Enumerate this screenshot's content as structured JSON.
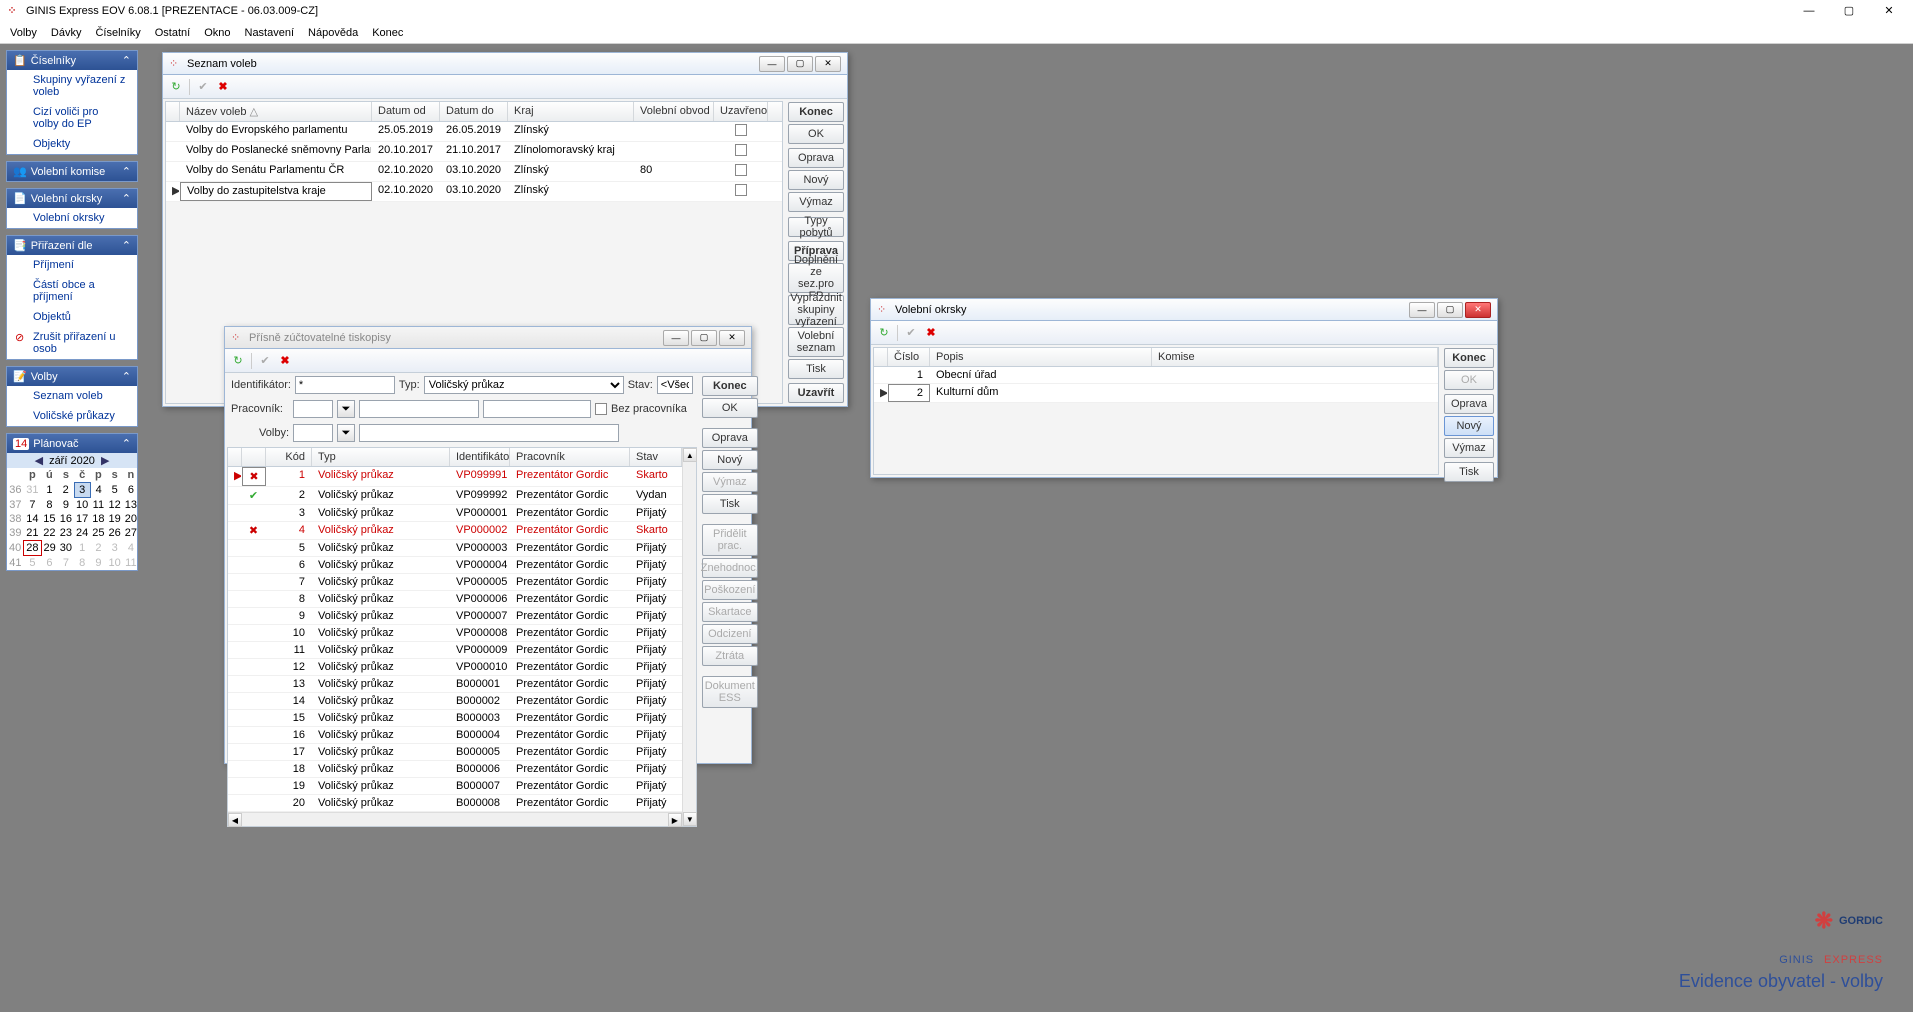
{
  "app": {
    "title": "GINIS Express EOV 6.08.1 [PREZENTACE - 06.03.009-CZ]"
  },
  "menu": [
    "Volby",
    "Dávky",
    "Číselníky",
    "Ostatní",
    "Okno",
    "Nastavení",
    "Nápověda",
    "Konec"
  ],
  "sidebar": {
    "ciselniky": {
      "title": "Číselníky",
      "items": [
        "Skupiny vyřazení z voleb",
        "Cizí voliči pro volby do EP",
        "Objekty"
      ]
    },
    "komise": {
      "title": "Volební komise"
    },
    "okrsky": {
      "title": "Volební okrsky",
      "items": [
        "Volební okrsky"
      ]
    },
    "prirazeni": {
      "title": "Přiřazení dle",
      "items": [
        "Příjmení",
        "Částí obce a příjmení",
        "Objektů",
        "Zrušit přiřazení u osob"
      ]
    },
    "volby": {
      "title": "Volby",
      "items": [
        "Seznam voleb",
        "Voličské průkazy"
      ]
    },
    "planovac": {
      "title": "Plánovač",
      "month": "září 2020"
    }
  },
  "calendar": {
    "days": [
      "p",
      "ú",
      "s",
      "č",
      "p",
      "s",
      "n"
    ],
    "weeks": [
      {
        "wk": "36",
        "d": [
          "31",
          "1",
          "2",
          "3",
          "4",
          "5",
          "6"
        ],
        "flags": [
          "out",
          "",
          "",
          "sel",
          "",
          "",
          ""
        ]
      },
      {
        "wk": "37",
        "d": [
          "7",
          "8",
          "9",
          "10",
          "11",
          "12",
          "13"
        ]
      },
      {
        "wk": "38",
        "d": [
          "14",
          "15",
          "16",
          "17",
          "18",
          "19",
          "20"
        ]
      },
      {
        "wk": "39",
        "d": [
          "21",
          "22",
          "23",
          "24",
          "25",
          "26",
          "27"
        ]
      },
      {
        "wk": "40",
        "d": [
          "28",
          "29",
          "30",
          "1",
          "2",
          "3",
          "4"
        ],
        "flags": [
          "today",
          "",
          "",
          "out",
          "out",
          "out",
          "out"
        ]
      },
      {
        "wk": "41",
        "d": [
          "5",
          "6",
          "7",
          "8",
          "9",
          "10",
          "11"
        ],
        "flags": [
          "out",
          "out",
          "out",
          "out",
          "out",
          "out",
          "out"
        ]
      }
    ]
  },
  "win_seznam": {
    "title": "Seznam voleb",
    "cols": [
      "Název voleb",
      "Datum od",
      "Datum do",
      "Kraj",
      "Volební obvod",
      "Uzavřeno"
    ],
    "rows": [
      {
        "nazev": "Volby do Evropského parlamentu",
        "od": "25.05.2019",
        "do": "26.05.2019",
        "kraj": "Zlínský",
        "obvod": "",
        "uz": false
      },
      {
        "nazev": "Volby do Poslanecké sněmovny Parlamentu ČR",
        "od": "20.10.2017",
        "do": "21.10.2017",
        "kraj": "Zlínolomoravský kraj",
        "obvod": "",
        "uz": false
      },
      {
        "nazev": "Volby do Senátu Parlamentu ČR",
        "od": "02.10.2020",
        "do": "03.10.2020",
        "kraj": "Zlínský",
        "obvod": "80",
        "uz": false
      },
      {
        "nazev": "Volby do zastupitelstva kraje",
        "od": "02.10.2020",
        "do": "03.10.2020",
        "kraj": "Zlínský",
        "obvod": "",
        "uz": false,
        "sel": true
      }
    ],
    "btns": {
      "konec": "Konec",
      "ok": "OK",
      "oprava": "Oprava",
      "novy": "Nový",
      "vymaz": "Výmaz",
      "typy": "Typy pobytů",
      "priprava": "Příprava",
      "doplneni": "Doplnění ze sez.pro EP",
      "vyprazdnit": "Vyprázdnit skupiny vyřazení",
      "seznam": "Volební seznam",
      "tisk": "Tisk",
      "uzavrit": "Uzavřít"
    }
  },
  "win_okrsky": {
    "title": "Volební okrsky",
    "cols": [
      "Číslo",
      "Popis",
      "Komise"
    ],
    "rows": [
      {
        "cislo": "1",
        "popis": "Obecní úřad",
        "komise": ""
      },
      {
        "cislo": "2",
        "popis": "Kulturní dům",
        "komise": "",
        "sel": true
      }
    ],
    "btns": {
      "konec": "Konec",
      "ok": "OK",
      "oprava": "Oprava",
      "novy": "Nový",
      "vymaz": "Výmaz",
      "tisk": "Tisk"
    }
  },
  "win_tiskopisy": {
    "title": "Přísně zúčtovatelné tiskopisy",
    "filter": {
      "ident_label": "Identifikátor:",
      "ident_val": "*",
      "typ_label": "Typ:",
      "typ_val": "Voličský průkaz",
      "stav_label": "Stav:",
      "stav_val": "<Všec",
      "prac_label": "Pracovník:",
      "bez_prac": "Bez pracovníka",
      "volby_label": "Volby:"
    },
    "cols": [
      "",
      "Kód",
      "Typ",
      "Identifikátor",
      "Pracovník",
      "Stav"
    ],
    "rows": [
      {
        "ico": "x",
        "kod": "1",
        "typ": "Voličský průkaz",
        "id": "VP099991",
        "prac": "Prezentátor Gordic",
        "stav": "Skarto",
        "red": true,
        "sel": true
      },
      {
        "ico": "v",
        "kod": "2",
        "typ": "Voličský průkaz",
        "id": "VP099992",
        "prac": "Prezentátor Gordic",
        "stav": "Vydan"
      },
      {
        "ico": "",
        "kod": "3",
        "typ": "Voličský průkaz",
        "id": "VP000001",
        "prac": "Prezentátor Gordic",
        "stav": "Přijatý"
      },
      {
        "ico": "x",
        "kod": "4",
        "typ": "Voličský průkaz",
        "id": "VP000002",
        "prac": "Prezentátor Gordic",
        "stav": "Skarto",
        "red": true
      },
      {
        "ico": "",
        "kod": "5",
        "typ": "Voličský průkaz",
        "id": "VP000003",
        "prac": "Prezentátor Gordic",
        "stav": "Přijatý"
      },
      {
        "ico": "",
        "kod": "6",
        "typ": "Voličský průkaz",
        "id": "VP000004",
        "prac": "Prezentátor Gordic",
        "stav": "Přijatý"
      },
      {
        "ico": "",
        "kod": "7",
        "typ": "Voličský průkaz",
        "id": "VP000005",
        "prac": "Prezentátor Gordic",
        "stav": "Přijatý"
      },
      {
        "ico": "",
        "kod": "8",
        "typ": "Voličský průkaz",
        "id": "VP000006",
        "prac": "Prezentátor Gordic",
        "stav": "Přijatý"
      },
      {
        "ico": "",
        "kod": "9",
        "typ": "Voličský průkaz",
        "id": "VP000007",
        "prac": "Prezentátor Gordic",
        "stav": "Přijatý"
      },
      {
        "ico": "",
        "kod": "10",
        "typ": "Voličský průkaz",
        "id": "VP000008",
        "prac": "Prezentátor Gordic",
        "stav": "Přijatý"
      },
      {
        "ico": "",
        "kod": "11",
        "typ": "Voličský průkaz",
        "id": "VP000009",
        "prac": "Prezentátor Gordic",
        "stav": "Přijatý"
      },
      {
        "ico": "",
        "kod": "12",
        "typ": "Voličský průkaz",
        "id": "VP000010",
        "prac": "Prezentátor Gordic",
        "stav": "Přijatý"
      },
      {
        "ico": "",
        "kod": "13",
        "typ": "Voličský průkaz",
        "id": "B000001",
        "prac": "Prezentátor Gordic",
        "stav": "Přijatý"
      },
      {
        "ico": "",
        "kod": "14",
        "typ": "Voličský průkaz",
        "id": "B000002",
        "prac": "Prezentátor Gordic",
        "stav": "Přijatý"
      },
      {
        "ico": "",
        "kod": "15",
        "typ": "Voličský průkaz",
        "id": "B000003",
        "prac": "Prezentátor Gordic",
        "stav": "Přijatý"
      },
      {
        "ico": "",
        "kod": "16",
        "typ": "Voličský průkaz",
        "id": "B000004",
        "prac": "Prezentátor Gordic",
        "stav": "Přijatý"
      },
      {
        "ico": "",
        "kod": "17",
        "typ": "Voličský průkaz",
        "id": "B000005",
        "prac": "Prezentátor Gordic",
        "stav": "Přijatý"
      },
      {
        "ico": "",
        "kod": "18",
        "typ": "Voličský průkaz",
        "id": "B000006",
        "prac": "Prezentátor Gordic",
        "stav": "Přijatý"
      },
      {
        "ico": "",
        "kod": "19",
        "typ": "Voličský průkaz",
        "id": "B000007",
        "prac": "Prezentátor Gordic",
        "stav": "Přijatý"
      },
      {
        "ico": "",
        "kod": "20",
        "typ": "Voličský průkaz",
        "id": "B000008",
        "prac": "Prezentátor Gordic",
        "stav": "Přijatý"
      }
    ],
    "btns": {
      "konec": "Konec",
      "ok": "OK",
      "oprava": "Oprava",
      "novy": "Nový",
      "vymaz": "Výmaz",
      "tisk": "Tisk",
      "pridelit": "Přidělit prac.",
      "znehod": "Znehodnoc.",
      "poskoz": "Poškození",
      "skart": "Skartace",
      "odciz": "Odcizení",
      "ztrata": "Ztráta",
      "ess": "Dokument ESS"
    }
  },
  "branding": {
    "l1": "GORDIC",
    "l2a": "GINIS",
    "l2b": "EXPRESS",
    "l3": "Evidence obyvatel - volby"
  }
}
